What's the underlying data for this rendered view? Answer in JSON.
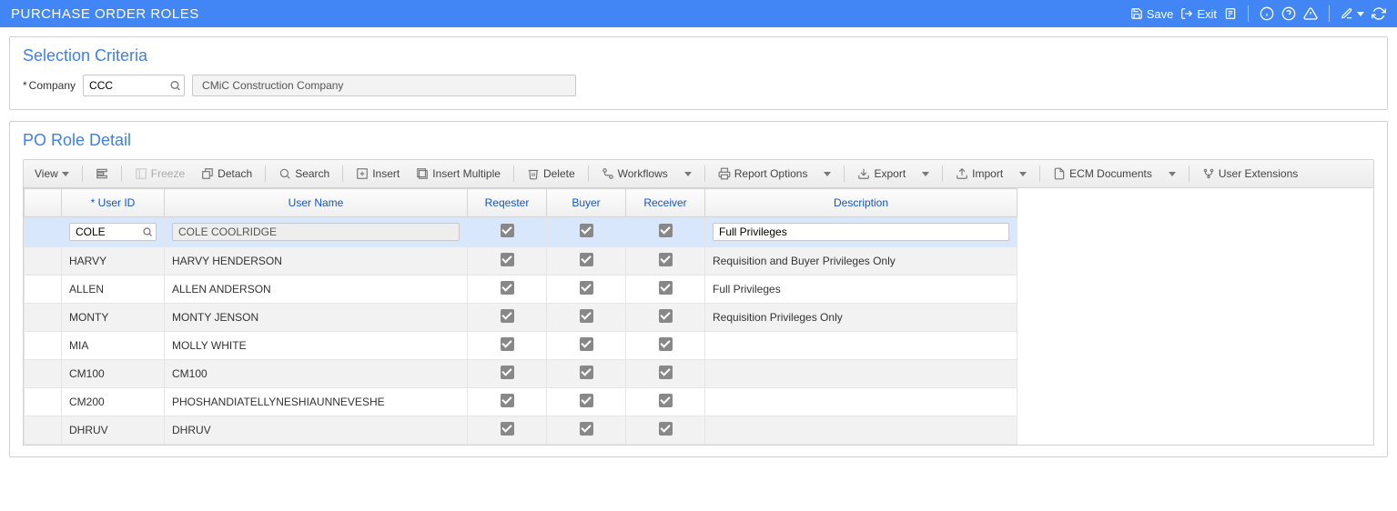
{
  "header": {
    "title": "PURCHASE ORDER ROLES",
    "save_label": "Save",
    "exit_label": "Exit"
  },
  "selection": {
    "title": "Selection Criteria",
    "company_label": "Company",
    "company_value": "CCC",
    "company_name": "CMiC Construction Company"
  },
  "detail": {
    "title": "PO Role Detail"
  },
  "toolbar": {
    "view": "View",
    "freeze": "Freeze",
    "detach": "Detach",
    "search": "Search",
    "insert": "Insert",
    "insert_multiple": "Insert Multiple",
    "delete": "Delete",
    "workflows": "Workflows",
    "report_options": "Report Options",
    "export": "Export",
    "import": "Import",
    "ecm_documents": "ECM Documents",
    "user_extensions": "User Extensions"
  },
  "columns": {
    "user_id": "* User ID",
    "user_name": "User Name",
    "requester": "Reqester",
    "buyer": "Buyer",
    "receiver": "Receiver",
    "description": "Description"
  },
  "rows": [
    {
      "user_id": "COLE",
      "user_name": "COLE COOLRIDGE",
      "req": true,
      "buy": true,
      "rec": true,
      "desc": "Full Privileges",
      "selected": true,
      "editable": true
    },
    {
      "user_id": "HARVY",
      "user_name": "HARVY HENDERSON",
      "req": true,
      "buy": true,
      "rec": true,
      "desc": "Requisition and Buyer Privileges Only",
      "alt": true
    },
    {
      "user_id": "ALLEN",
      "user_name": "ALLEN ANDERSON",
      "req": true,
      "buy": true,
      "rec": true,
      "desc": "Full Privileges"
    },
    {
      "user_id": "MONTY",
      "user_name": "MONTY JENSON",
      "req": true,
      "buy": true,
      "rec": true,
      "desc": "Requisition Privileges Only",
      "alt": true
    },
    {
      "user_id": "MIA",
      "user_name": "MOLLY WHITE",
      "req": true,
      "buy": true,
      "rec": true,
      "desc": ""
    },
    {
      "user_id": "CM100",
      "user_name": "CM100",
      "req": true,
      "buy": true,
      "rec": true,
      "desc": "",
      "alt": true
    },
    {
      "user_id": "CM200",
      "user_name": "PHOSHANDIATELLYNESHIAUNNEVESHE",
      "req": true,
      "buy": true,
      "rec": true,
      "desc": ""
    },
    {
      "user_id": "DHRUV",
      "user_name": "DHRUV",
      "req": true,
      "buy": true,
      "rec": true,
      "desc": "",
      "alt": true
    }
  ]
}
